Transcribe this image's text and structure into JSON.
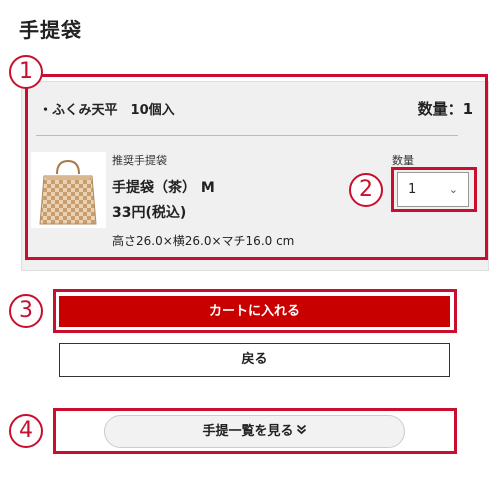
{
  "page": {
    "title": "手提袋"
  },
  "annotations": [
    "1",
    "2",
    "3",
    "4"
  ],
  "item": {
    "name": "・ふくみ天平　10個入",
    "quantity_summary": "数量：1"
  },
  "product": {
    "recommend_label": "推奨手提袋",
    "title": "手提袋（茶） M",
    "price": "33円(税込)",
    "dimensions": "高さ26.0×横26.0×マチ16.0 cm",
    "image_icon": "paper-bag-checkered"
  },
  "quantity": {
    "label": "数量",
    "selected": "1"
  },
  "buttons": {
    "add_to_cart": "カートに入れる",
    "back": "戻る",
    "view_list": "手提一覧を見る"
  },
  "colors": {
    "accent": "#c80000",
    "annotation": "#c8102e",
    "panel_bg": "#f0f0f0"
  }
}
